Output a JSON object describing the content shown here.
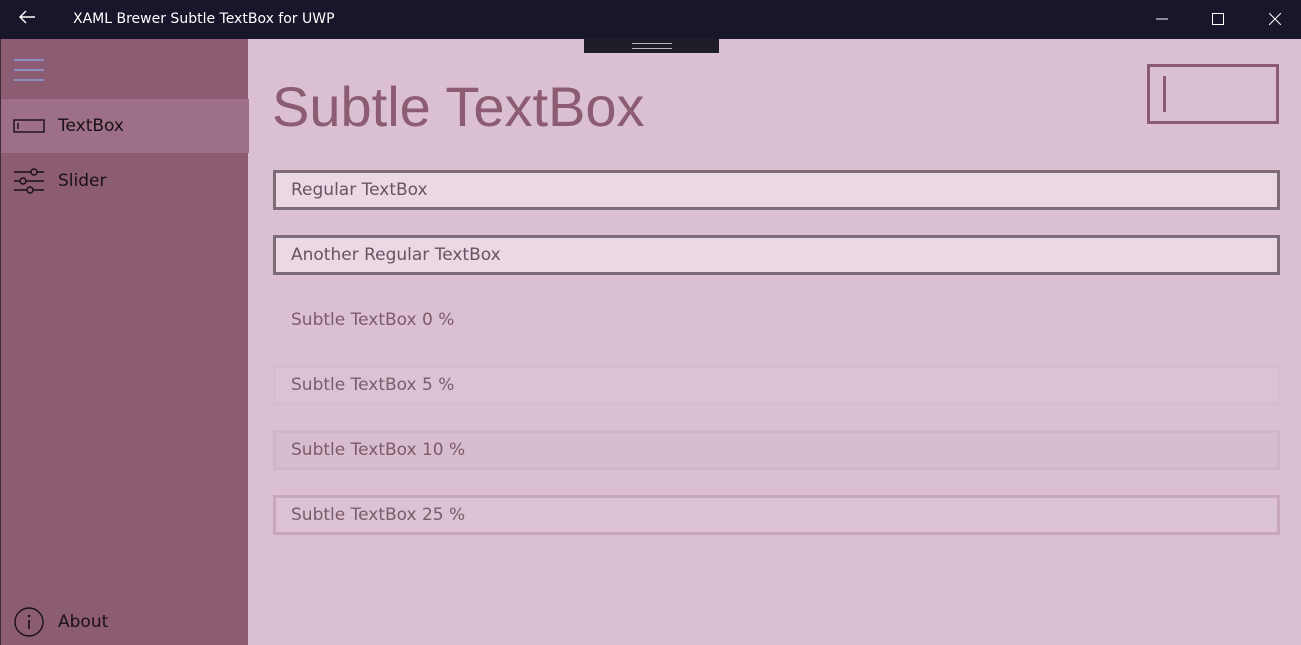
{
  "window": {
    "title": "XAML Brewer Subtle TextBox for UWP",
    "accent": "#8c5d72",
    "titlebar_color": "#17162b",
    "background": "#dbc0d2"
  },
  "titlebar": {
    "back_icon": "arrow-left-icon",
    "minimize_icon": "minimize-icon",
    "maximize_icon": "maximize-icon",
    "close_icon": "close-icon"
  },
  "sidebar": {
    "hamburger_icon": "hamburger-icon",
    "items": [
      {
        "label": "TextBox",
        "icon": "textbox-icon",
        "selected": true
      },
      {
        "label": "Slider",
        "icon": "sliders-icon",
        "selected": false
      },
      {
        "label": "About",
        "icon": "info-icon",
        "selected": false
      }
    ]
  },
  "main": {
    "title": "Subtle TextBox",
    "textboxes": [
      {
        "placeholder": "Regular TextBox",
        "style": "regular"
      },
      {
        "placeholder": "Another Regular TextBox",
        "style": "regular"
      },
      {
        "placeholder": "Subtle TextBox 0 %",
        "style": "subtle",
        "opacity_percent": 0
      },
      {
        "placeholder": "Subtle TextBox 5 %",
        "style": "subtle",
        "opacity_percent": 5
      },
      {
        "placeholder": "Subtle TextBox 10 %",
        "style": "subtle",
        "opacity_percent": 10
      },
      {
        "placeholder": "Subtle TextBox 25 %",
        "style": "subtle",
        "opacity_percent": 25
      }
    ]
  }
}
